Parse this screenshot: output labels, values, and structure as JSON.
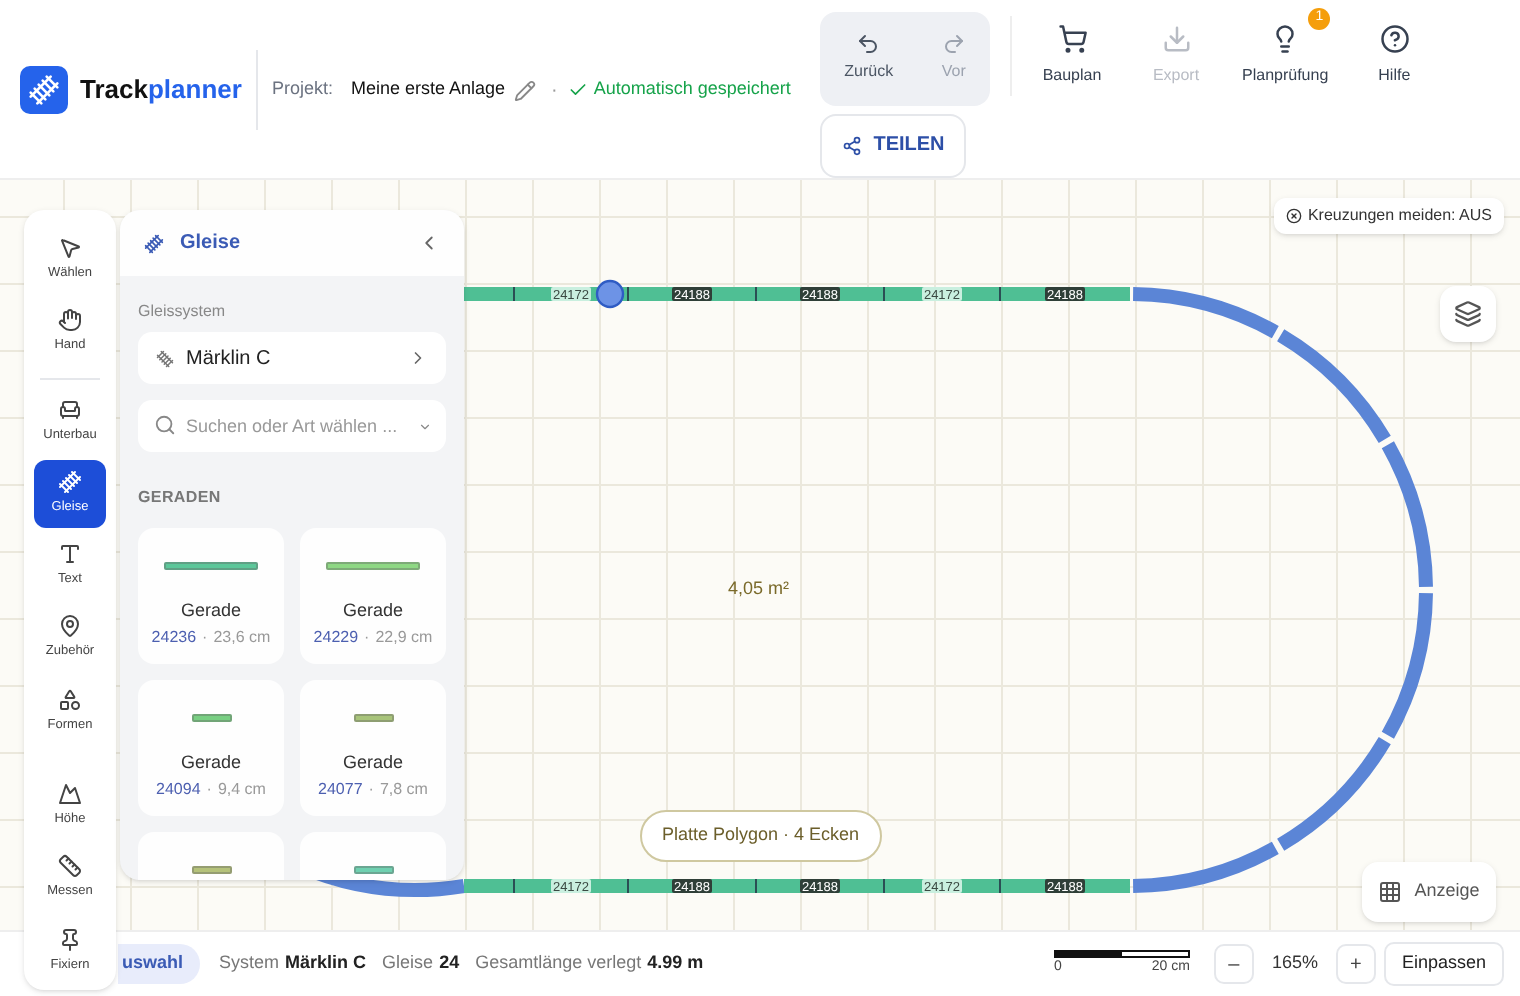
{
  "header": {
    "logo": {
      "word_dark": "Track",
      "word_accent": "planner"
    },
    "project_label": "Projekt:",
    "project_name": "Meine erste Anlage",
    "separator": "·",
    "save_status": "Automatisch gespeichert",
    "history": [
      {
        "label": "Zurück",
        "kind": "undo",
        "disabled": false
      },
      {
        "label": "Vor",
        "kind": "redo",
        "disabled": true
      }
    ],
    "share_button": "TEILEN",
    "actions": [
      {
        "label": "Bauplan",
        "kind": "cart",
        "disabled": false
      },
      {
        "label": "Export",
        "kind": "download",
        "disabled": true
      },
      {
        "label": "Planprüfung",
        "kind": "bulb",
        "disabled": false,
        "badge": "1"
      },
      {
        "label": "Hilfe",
        "kind": "help",
        "disabled": false
      }
    ]
  },
  "tools": [
    {
      "label": "Wählen",
      "kind": "pointer",
      "selected": false
    },
    {
      "label": "Hand",
      "kind": "hand",
      "selected": false
    },
    {
      "label": "Unterbau",
      "kind": "base",
      "selected": false
    },
    {
      "label": "Gleise",
      "kind": "track",
      "selected": true
    },
    {
      "label": "Text",
      "kind": "text",
      "selected": false
    },
    {
      "label": "Zubehör",
      "kind": "accessory",
      "selected": false
    },
    {
      "label": "Formen",
      "kind": "shapes",
      "selected": false
    },
    {
      "label": "Höhe",
      "kind": "height",
      "selected": false
    },
    {
      "label": "Messen",
      "kind": "ruler",
      "selected": false
    },
    {
      "label": "Fixiern",
      "kind": "pin",
      "selected": false
    }
  ],
  "panel": {
    "title": "Gleise",
    "system_label": "Gleissystem",
    "system": "Märklin C",
    "search": {
      "placeholder": "Suchen oder Art wählen ..."
    },
    "section": "GERADEN",
    "cards": [
      {
        "name": "Gerade",
        "number": "24236",
        "separator": "·",
        "length": "23,6 cm",
        "color": "#5cc79a",
        "kind": "long"
      },
      {
        "name": "Gerade",
        "number": "24229",
        "separator": "·",
        "length": "22,9 cm",
        "color": "#8ed884",
        "kind": "long"
      },
      {
        "name": "Gerade",
        "number": "24094",
        "separator": "·",
        "length": "9,4 cm",
        "color": "#78cf82",
        "kind": "short"
      },
      {
        "name": "Gerade",
        "number": "24077",
        "separator": "·",
        "length": "7,8 cm",
        "color": "#a8c47a",
        "kind": "short"
      },
      {
        "color": "#b5c27a",
        "kind": "short"
      },
      {
        "color": "#6fd0b0",
        "kind": "short"
      }
    ]
  },
  "canvas": {
    "crossings_toggle": "Kreuzungen meiden: AUS",
    "area_label": "4,05 m²",
    "shape_label": "Platte Polygon · 4 Ecken",
    "display_button": "Anzeige",
    "top_segments": [
      {
        "label": "24172",
        "kind": "light"
      },
      {
        "label": "24188",
        "kind": "dark"
      },
      {
        "label": "24188",
        "kind": "dark"
      },
      {
        "label": "24172",
        "kind": "light"
      },
      {
        "label": "24188",
        "kind": "dark"
      }
    ],
    "bottom_segments": [
      {
        "label": "24172",
        "kind": "light"
      },
      {
        "label": "24188",
        "kind": "dark"
      },
      {
        "label": "24188",
        "kind": "dark"
      },
      {
        "label": "24172",
        "kind": "light"
      },
      {
        "label": "24188",
        "kind": "dark"
      }
    ]
  },
  "status_bar": {
    "selection_badge": "uswahl",
    "system_label": "System",
    "system": "Märklin C",
    "tracks_label": "Gleise",
    "tracks": "24",
    "length_label": "Gesamtlänge verlegt",
    "length": "4.99 m",
    "scale_start": "0",
    "scale_end": "20 cm",
    "zoom_out": "–",
    "zoom": "165%",
    "zoom_in": "+",
    "fit_button": "Einpassen"
  }
}
